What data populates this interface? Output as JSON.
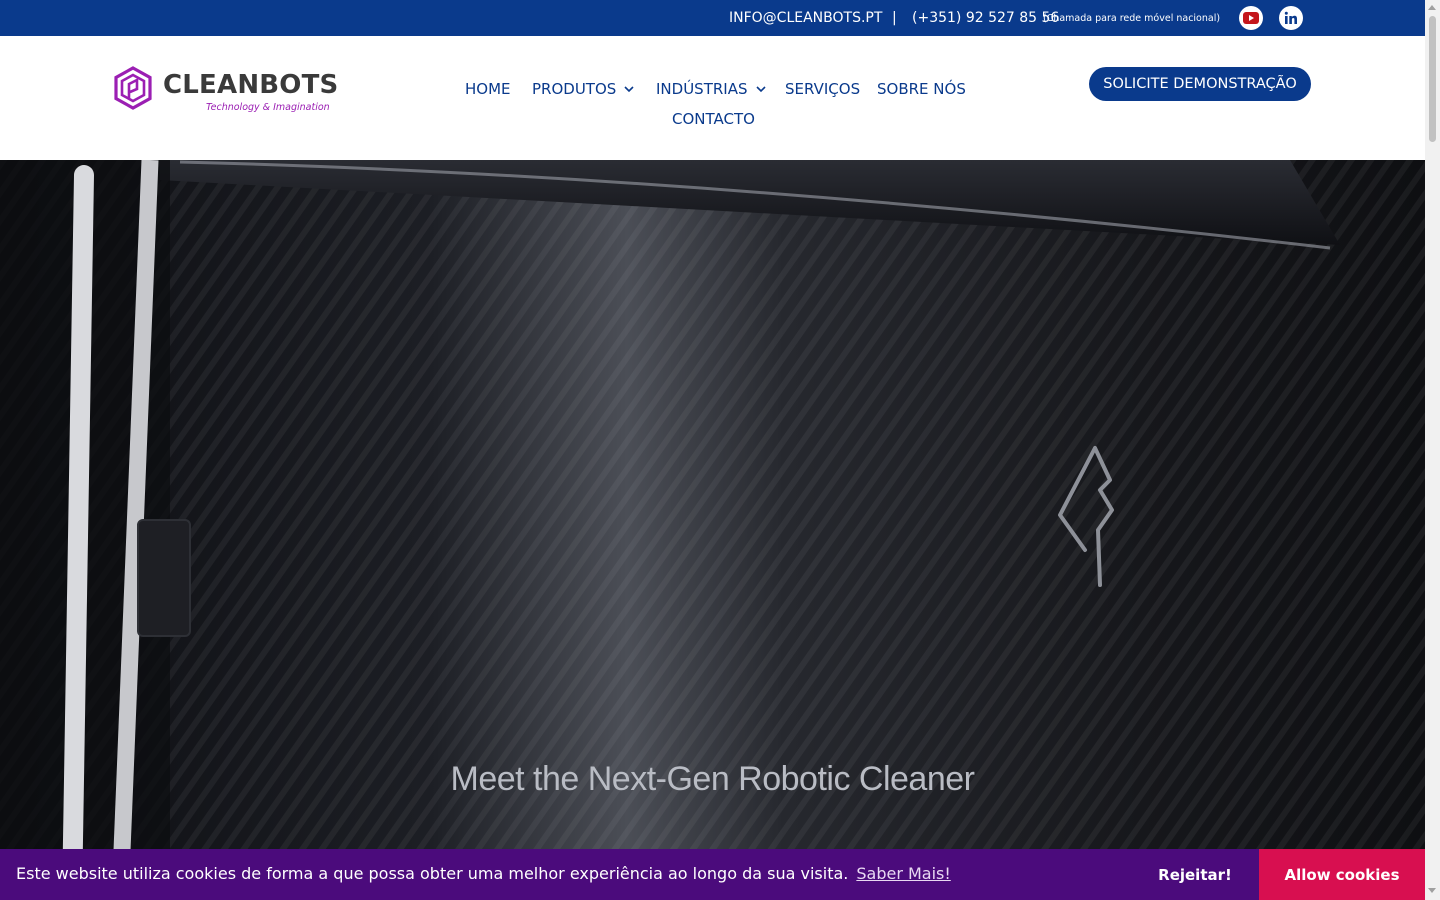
{
  "topbar": {
    "email": "INFO@CLEANBOTS.PT",
    "separator": "|",
    "phone": "(+351) 92 527 85 56",
    "phone_note": "(Chamada para rede móvel nacional)",
    "icons": [
      "youtube-icon",
      "linkedin-icon"
    ]
  },
  "logo": {
    "brand": "CLEANBOTS",
    "tagline": "Technology & Imagination"
  },
  "nav": {
    "home": "HOME",
    "produtos": "PRODUTOS",
    "industrias": "INDÚSTRIAS",
    "servicos": "SERVIÇOS",
    "sobre": "SOBRE NÓS",
    "contacto": "CONTACTO"
  },
  "cta": {
    "label": "SOLICITE DEMONSTRAÇÃO"
  },
  "hero": {
    "caption": "Meet the Next-Gen Robotic Cleaner"
  },
  "cookie": {
    "message": "Este website utiliza cookies de forma a que possa obter uma melhor experiência ao longo da sua visita.",
    "learn_more": "Saber Mais!",
    "reject": "Rejeitar!",
    "allow": "Allow cookies"
  },
  "colors": {
    "brand_blue": "#0a3a8c",
    "brand_purple": "#9b1fb3",
    "cookie_bg": "#4b0b7c",
    "allow_bg": "#d80f50"
  }
}
